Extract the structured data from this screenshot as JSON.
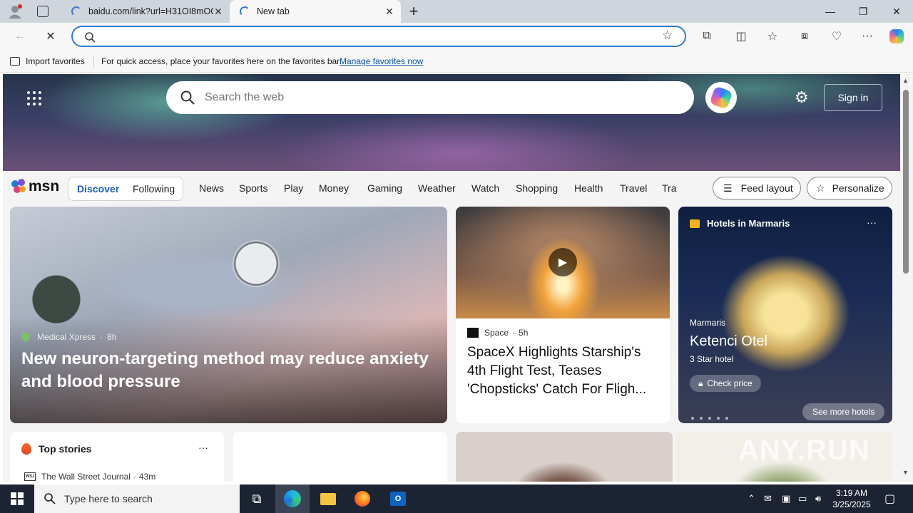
{
  "browser": {
    "tabs": [
      {
        "title": "baidu.com/link?url=H31OI8mOG",
        "active": false
      },
      {
        "title": "New tab",
        "active": true
      }
    ],
    "new_tab_symbol": "+",
    "address": {
      "value": "",
      "placeholder": ""
    },
    "window_controls": {
      "minimize": "—",
      "restore": "❐",
      "close": "✕"
    }
  },
  "favorites_bar": {
    "import_label": "Import favorites",
    "hint": "For quick access, place your favorites here on the favorites bar.",
    "manage_link": "Manage favorites now"
  },
  "newtab": {
    "search_placeholder": "Search the web",
    "sign_in": "Sign in",
    "logo_text": "msn",
    "feed_tabs": {
      "discover": "Discover",
      "following": "Following"
    },
    "categories": [
      "News",
      "Sports",
      "Play",
      "Money",
      "Gaming",
      "Weather",
      "Watch",
      "Shopping",
      "Health",
      "Travel",
      "Tra"
    ],
    "feed_layout": "Feed layout",
    "personalize": "Personalize"
  },
  "cards": {
    "lead": {
      "source": "Medical Xpress",
      "age": "8h",
      "headline": "New neuron-targeting method may reduce anxiety and blood pressure"
    },
    "video": {
      "source": "Space",
      "age": "5h",
      "headline": "SpaceX Highlights Starship's 4th Flight Test, Teases 'Chopsticks' Catch For Fligh..."
    },
    "hotels": {
      "title": "Hotels in Marmaris",
      "location": "Marmaris",
      "name": "Ketenci Otel",
      "rating": "3 Star hotel",
      "check_price": "Check price",
      "see_more": "See more hotels",
      "more": "···"
    },
    "top_stories": {
      "title": "Top stories",
      "more": "···",
      "first_source": "The Wall Street Journal",
      "first_age": "43m",
      "source_logo": "WSJ"
    }
  },
  "watermark": "ANY.RUN",
  "taskbar": {
    "search_placeholder": "Type here to search",
    "time": "3:19 AM",
    "date": "3/25/2025"
  },
  "colors": {
    "accent": "#3577d4",
    "link": "#0b57a6",
    "taskbar": "#1c2433",
    "tabstrip": "#cfd5dc"
  }
}
